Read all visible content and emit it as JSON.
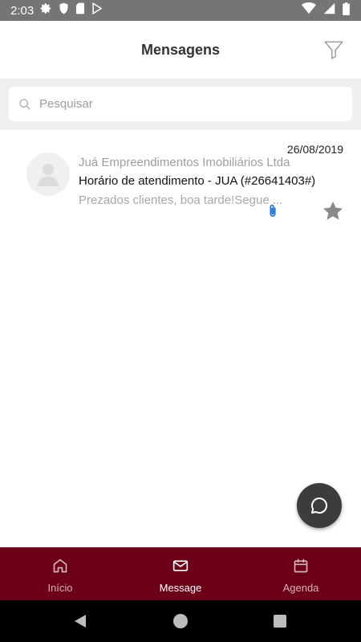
{
  "status_bar": {
    "time": "2:03",
    "left_icons": [
      "settings-icon",
      "shield-icon",
      "sd-card-icon",
      "play-store-icon"
    ],
    "right_icons": [
      "wifi-icon",
      "signal-icon",
      "battery-icon"
    ]
  },
  "header": {
    "title": "Mensagens",
    "filter_icon": "filter-icon"
  },
  "search": {
    "placeholder": "Pesquisar",
    "value": ""
  },
  "messages": [
    {
      "date": "26/08/2019",
      "sender": "Juá Empreendimentos Imobiliários Ltda",
      "subject": "Horário de atendimento - JUA (#26641403#)",
      "preview": "Prezados clientes, boa tarde!Segue ...",
      "has_attachment": true,
      "starred": false
    }
  ],
  "fab": {
    "icon": "chat-bubble-icon"
  },
  "bottom_nav": {
    "items": [
      {
        "label": "Início",
        "icon": "home-icon",
        "active": false
      },
      {
        "label": "Message",
        "icon": "mail-icon",
        "active": true
      },
      {
        "label": "Agenda",
        "icon": "calendar-icon",
        "active": false
      }
    ]
  },
  "colors": {
    "status_bar": "#757575",
    "bottom_nav": "#6b0016",
    "fab": "#3c3c3c",
    "attachment": "#1e6fd9",
    "star": "#8a8a8a"
  }
}
